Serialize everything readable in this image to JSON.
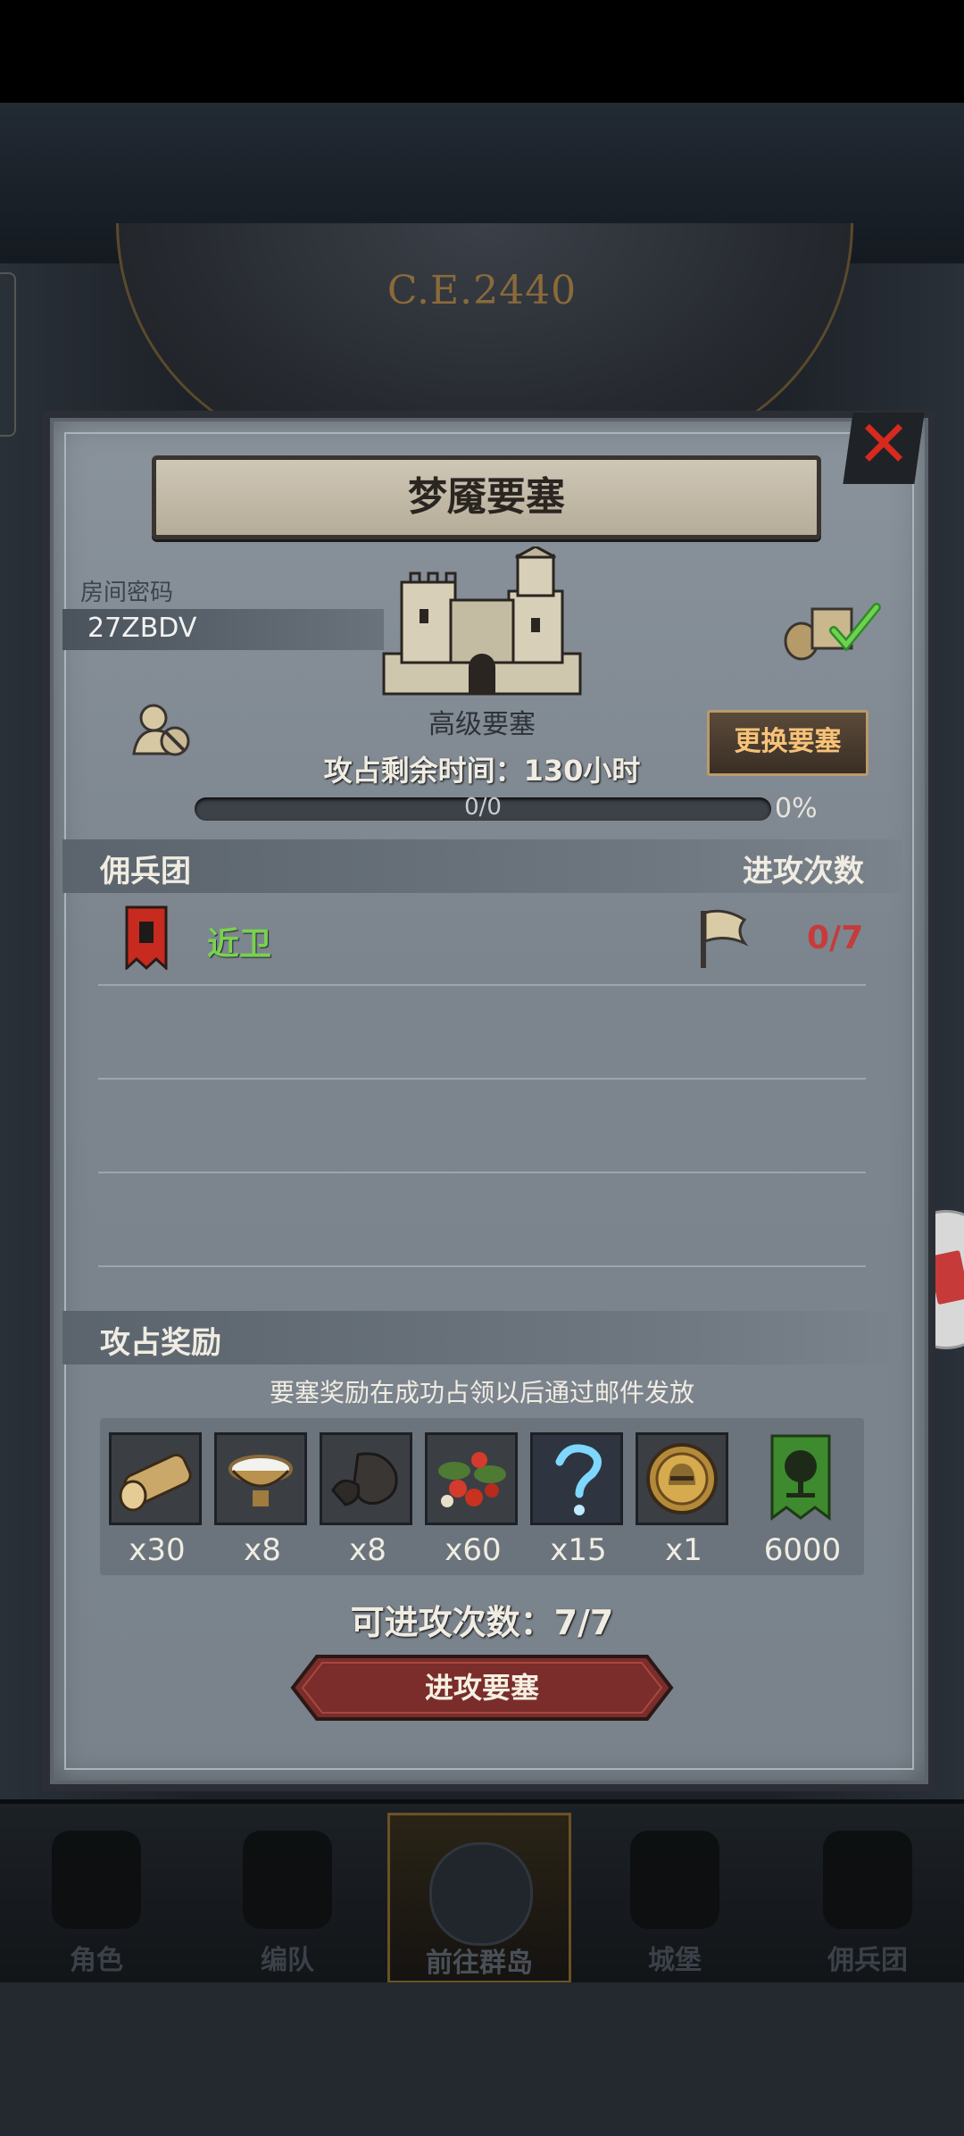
{
  "background": {
    "calendar_year": "C.E.2440"
  },
  "dialog": {
    "title": "梦魇要塞",
    "room_label": "房间密码",
    "room_code": "27ZBDV",
    "fortress_type": "高级要塞",
    "time_left": "攻占剩余时间：130小时",
    "change_button": "更换要塞",
    "progress": {
      "text": "0/0",
      "percent_label": "0%",
      "fraction": 0
    },
    "mercenary_section": {
      "left": "佣兵团",
      "right": "进攻次数"
    },
    "guilds": [
      {
        "name": "近卫",
        "attacks": "0/7",
        "flag_color": "#c72a1e"
      }
    ],
    "reward_section": {
      "title": "攻占奖励",
      "note": "要塞奖励在成功占领以后通过邮件发放"
    },
    "rewards": [
      {
        "icon": "wood-log-icon",
        "qty": "x30"
      },
      {
        "icon": "milk-bowl-icon",
        "qty": "x8"
      },
      {
        "icon": "ore-stone-icon",
        "qty": "x8"
      },
      {
        "icon": "berries-icon",
        "qty": "x60"
      },
      {
        "icon": "magic-question-icon",
        "qty": "x15"
      },
      {
        "icon": "knight-helmet-coin-icon",
        "qty": "x1"
      },
      {
        "icon": "tree-banner-icon",
        "qty": "6000"
      }
    ],
    "remaining_attacks": "可进攻次数：7/7",
    "attack_button": "进攻要塞"
  },
  "bottom_nav": [
    {
      "label": "角色"
    },
    {
      "label": "编队"
    },
    {
      "label": "前往群岛",
      "active": true
    },
    {
      "label": "城堡"
    },
    {
      "label": "佣兵团"
    }
  ],
  "colors": {
    "accent_gold": "#f6c277",
    "guild_green": "#7ad14f",
    "count_red": "#c53c3a",
    "close_red": "#d7291d"
  }
}
